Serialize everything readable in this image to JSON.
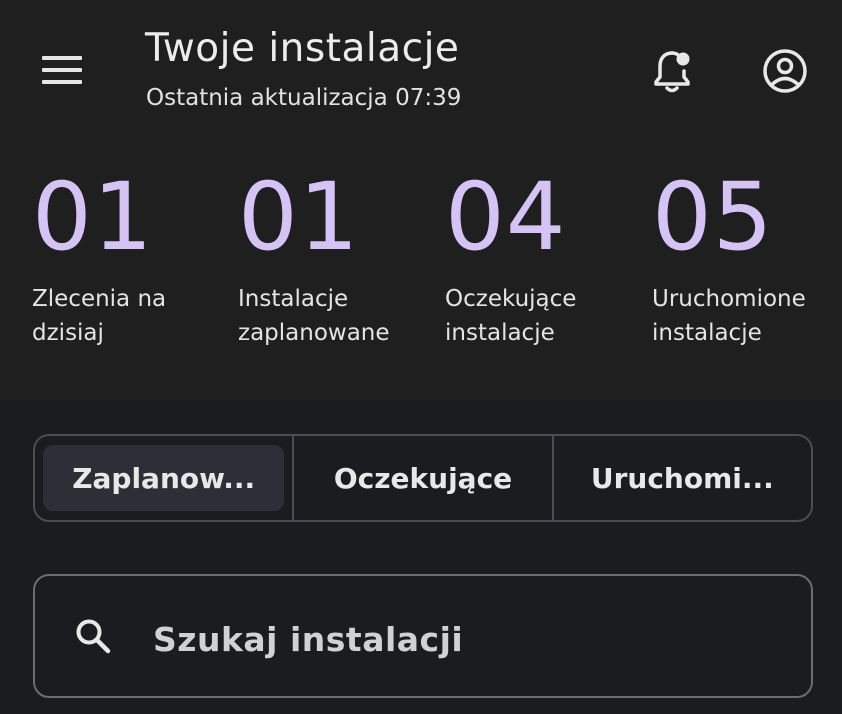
{
  "header": {
    "title": "Twoje instalacje",
    "subtitle": "Ostatnia aktualizacja 07:39",
    "menu_icon": "menu-icon",
    "notification_icon": "notification-bell-icon",
    "account_icon": "account-circle-icon"
  },
  "stats": [
    {
      "value": "01",
      "label": "Zlecenia na\ndzisiaj"
    },
    {
      "value": "01",
      "label": "Instalacje\nzaplanowane"
    },
    {
      "value": "04",
      "label": "Oczekujące\ninstalacje"
    },
    {
      "value": "05",
      "label": "Uruchomione\ninstalacje"
    }
  ],
  "tabs": [
    {
      "label": "Zaplanow...",
      "selected": true
    },
    {
      "label": "Oczekujące",
      "selected": false
    },
    {
      "label": "Uruchomi...",
      "selected": false
    }
  ],
  "search": {
    "placeholder": "Szukaj instalacji",
    "icon": "search-icon"
  },
  "colors": {
    "accent": "#d5c3f5",
    "header_bg": "#1f1f1f",
    "body_bg": "#1a1c1f"
  }
}
